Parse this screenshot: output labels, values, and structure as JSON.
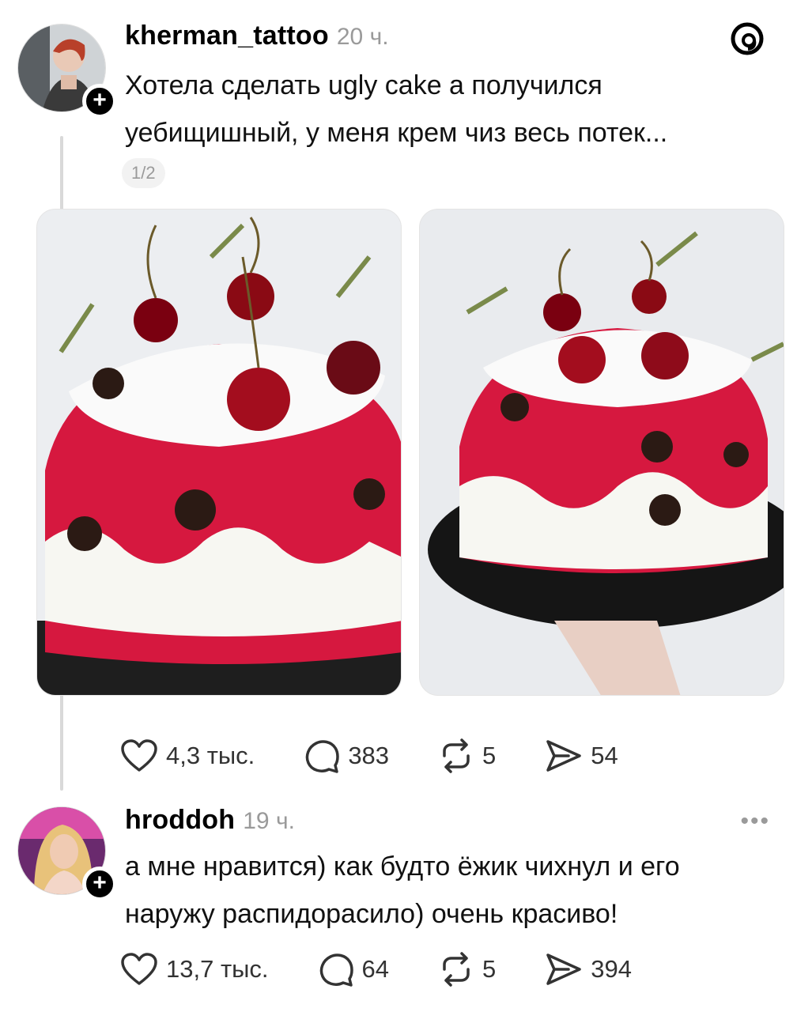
{
  "colors": {
    "accent": "#000000",
    "muted": "#9a9a9a",
    "cake_red": "#d6183f"
  },
  "posts": [
    {
      "username": "kherman_tattoo",
      "time": "20 ч.",
      "text": "Хотела сделать ugly cake а получился уебищишный, у меня крем чиз весь потек...",
      "page_indicator": "1/2",
      "images": [
        "cake-photo-1",
        "cake-photo-2"
      ],
      "actions": {
        "likes": "4,3 тыс.",
        "replies": "383",
        "reposts": "5",
        "shares": "54"
      }
    },
    {
      "username": "hroddoh",
      "time": "19 ч.",
      "text": "а мне нравится) как будто ёжик чихнул и его наружу распидорасило) очень красиво!",
      "more": "•••",
      "actions": {
        "likes": "13,7 тыс.",
        "replies": "64",
        "reposts": "5",
        "shares": "394"
      }
    }
  ]
}
